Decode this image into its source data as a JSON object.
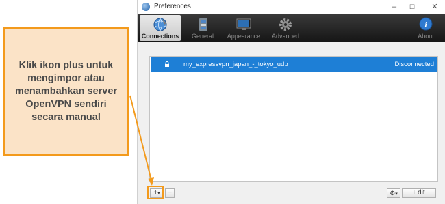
{
  "window": {
    "title": "Preferences"
  },
  "window_controls": {
    "minimize": "–",
    "maximize": "☐",
    "close": "✕"
  },
  "toolbar": {
    "items": [
      {
        "label": "Connections",
        "icon": "globe-icon",
        "active": true
      },
      {
        "label": "General",
        "icon": "switch-icon",
        "active": false
      },
      {
        "label": "Appearance",
        "icon": "monitor-icon",
        "active": false
      },
      {
        "label": "Advanced",
        "icon": "gear-icon",
        "active": false
      },
      {
        "label": "About",
        "icon": "info-icon",
        "active": false
      }
    ]
  },
  "connections": [
    {
      "name": "my_expressvpn_japan_-_tokyo_udp",
      "status": "Disconnected",
      "selected": true
    }
  ],
  "bottom_bar": {
    "add_label": "+",
    "add_menu": "▾",
    "remove_label": "−",
    "gear_menu": "▾",
    "edit_label": "Edit"
  },
  "annotation": {
    "text": "Klik ikon plus untuk mengimpor atau menambahkan server OpenVPN sendiri secara manual"
  },
  "colors": {
    "accent": "#f39a1c",
    "annotation_bg": "#fbe3c7",
    "selection": "#1e7fd6"
  }
}
